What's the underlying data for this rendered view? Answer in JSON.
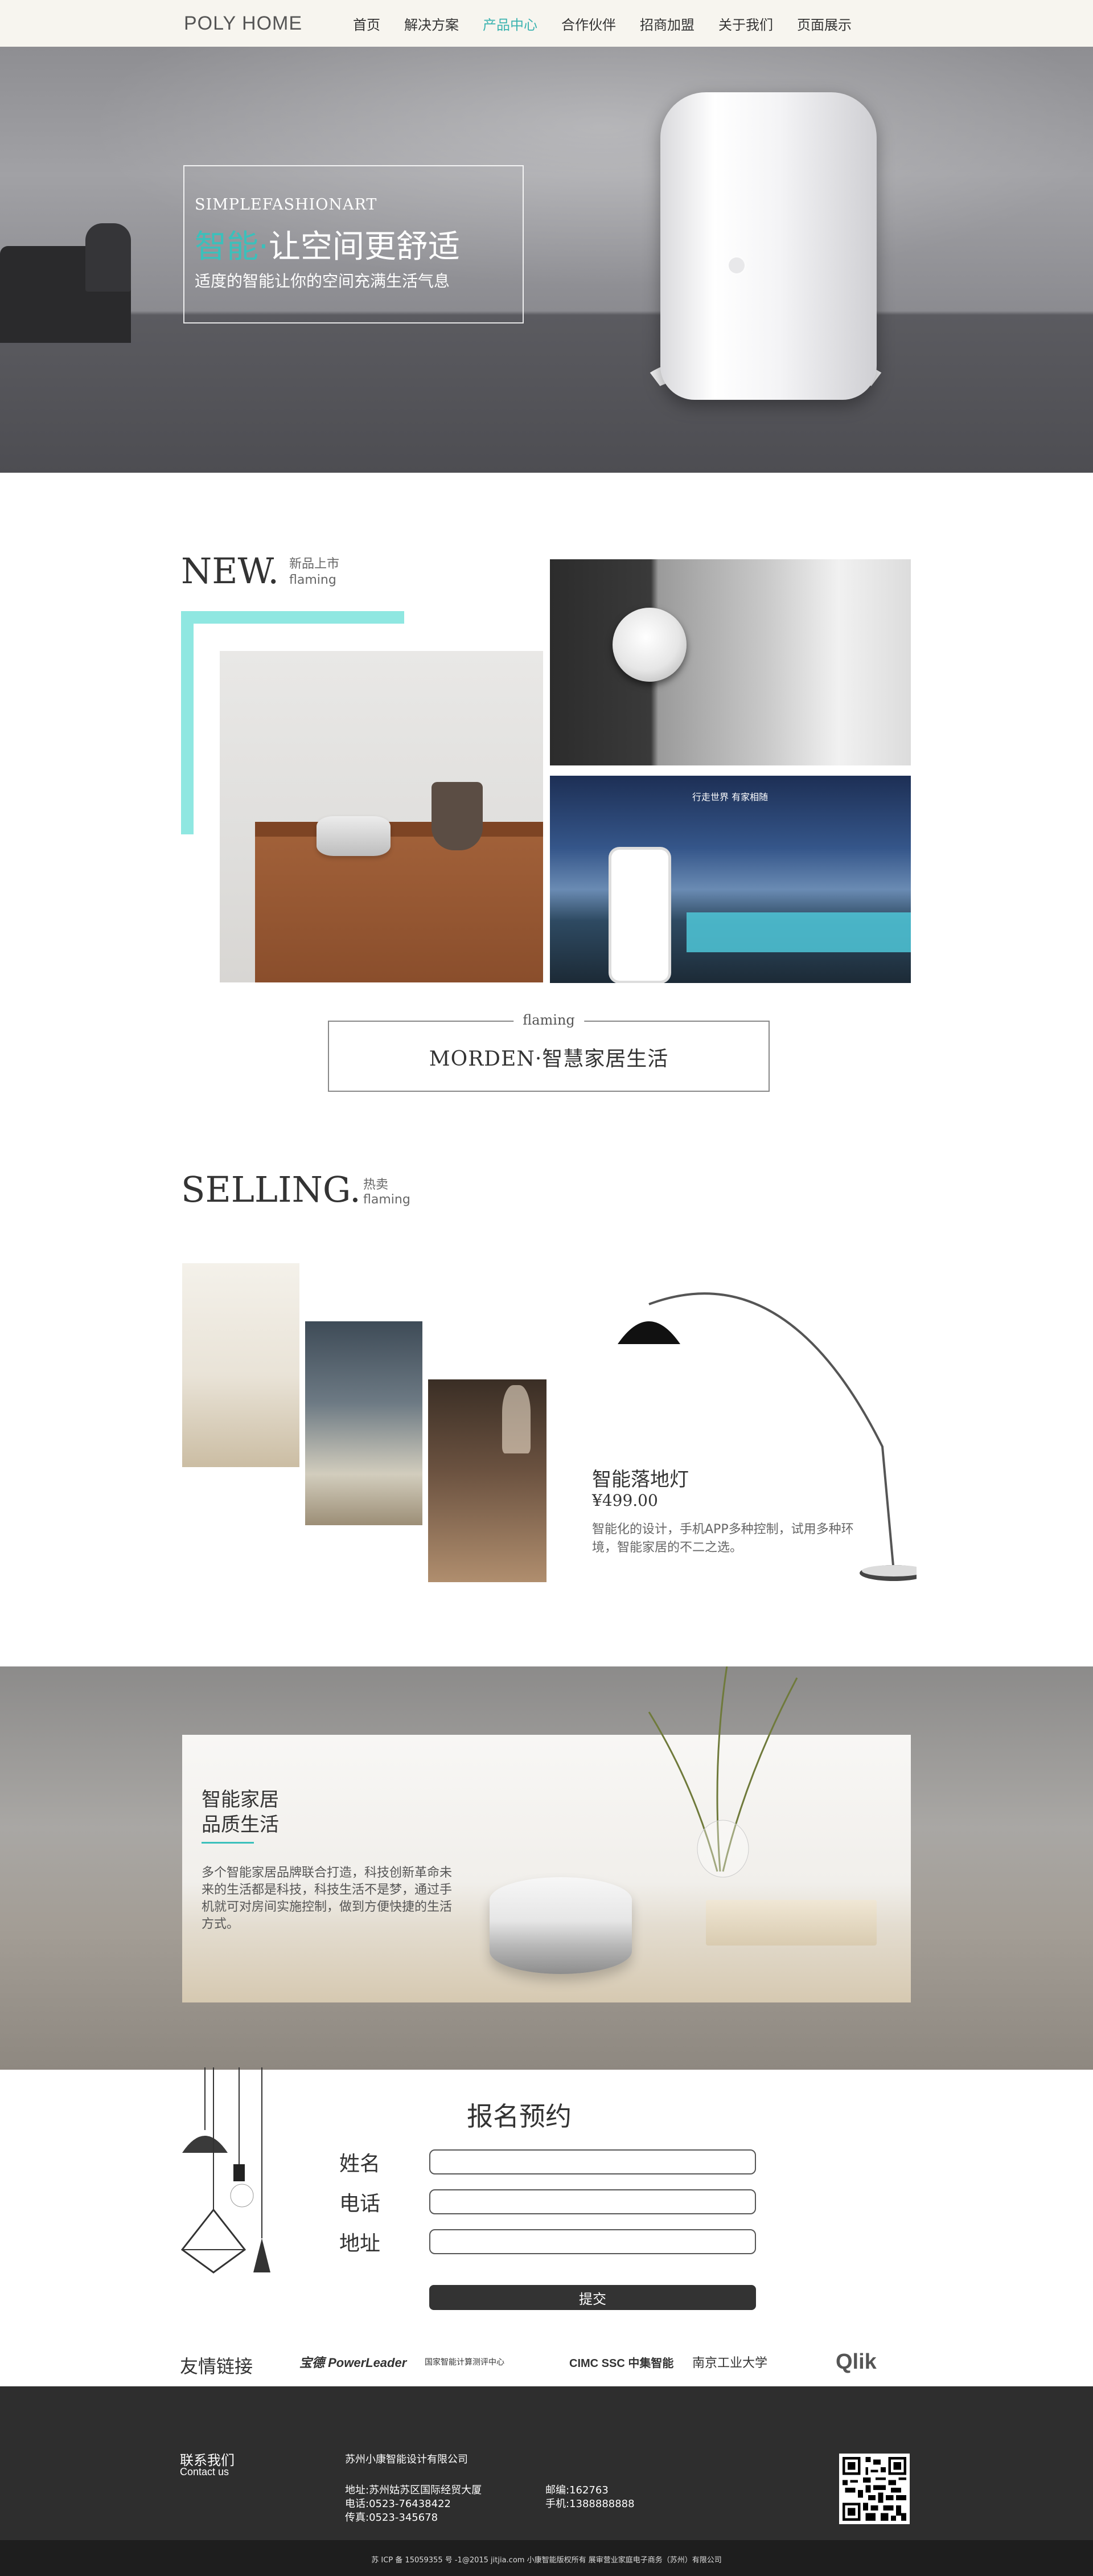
{
  "header": {
    "logo": "POLY HOME",
    "nav": [
      "首页",
      "解决方案",
      "产品中心",
      "合作伙伴",
      "招商加盟",
      "关于我们",
      "页面展示"
    ],
    "active_index": 2
  },
  "hero": {
    "subtitle": "SIMPLEFASHIONART",
    "title_accent": "智能·",
    "title_rest": "让空间更舒适",
    "desc": "适度的智能让你的空间充满生活气息"
  },
  "new_section": {
    "title": "NEW.",
    "sub_cn": "新品上市",
    "sub_en": "flaming",
    "image_caption": "行走世界 有家相随"
  },
  "morden": {
    "label": "flaming",
    "text": "MORDEN·智慧家居生活"
  },
  "selling": {
    "title": "SELLING.",
    "sub_cn": "热卖",
    "sub_en": "flaming",
    "product_name": "智能落地灯",
    "product_price": "¥499.00",
    "product_desc": "智能化的设计，手机APP多种控制，试用多种环境，智能家居的不二之选。"
  },
  "banner": {
    "title": "智能家居\n品质生活",
    "desc": "多个智能家居品牌联合打造，科技创新革命未来的生活都是科技，科技生活不是梦，通过手机就可对房间实施控制，做到方便快捷的生活方式。"
  },
  "form": {
    "title": "报名预约",
    "name_label": "姓名",
    "phone_label": "电话",
    "address_label": "地址",
    "submit": "提交"
  },
  "links": {
    "label": "友情链接",
    "partners": [
      "宝德 PowerLeader",
      "国家智能计算测评中心",
      "CIMC SSC 中集智能",
      "南京工业大学",
      "Qlik"
    ]
  },
  "footer": {
    "contact_title": "联系我们",
    "contact_sub": "Contact us",
    "company": "苏州小康智能设计有限公司",
    "address": "地址:苏州姑苏区国际经贸大厦",
    "phone": "电话:0523-76438422",
    "fax": "传真:0523-345678",
    "postcode": "邮编:162763",
    "mobile": "手机:1388888888",
    "copyright": "苏 ICP 备 15059355 号 -1@2015 jitjia.com 小康智能版权所有 展审营业家庭电子商务（苏州）有限公司"
  },
  "colors": {
    "accent": "#3bc0bb",
    "cyan_block": "#8fe7e1",
    "footer_bg": "#2e2e2e"
  }
}
